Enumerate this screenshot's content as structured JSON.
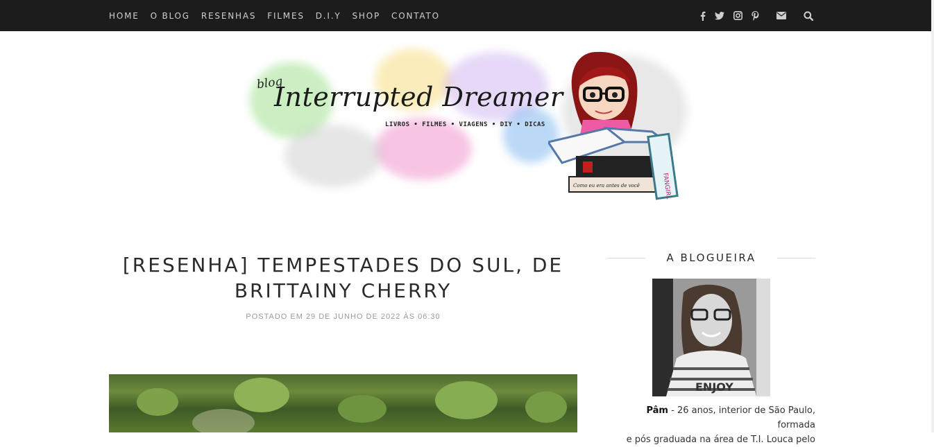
{
  "nav": {
    "items": [
      "HOME",
      "O BLOG",
      "RESENHAS",
      "FILMES",
      "D.I.Y",
      "SHOP",
      "CONTATO"
    ]
  },
  "social": {
    "icons": [
      "facebook-icon",
      "twitter-icon",
      "instagram-icon",
      "pinterest-icon",
      "envelope-icon",
      "search-icon"
    ]
  },
  "header": {
    "blog_word": "blog",
    "logo_title": "Interrupted Dreamer",
    "tagline": "LIVROS • FILMES • VIAGENS • DIY • DICAS",
    "book_spine_1": "Como eu era antes de você",
    "book_spine_2": "FANGIRL"
  },
  "post": {
    "title_line1": "[RESENHA] TEMPESTADES DO SUL, DE",
    "title_line2": "BRITTAINY CHERRY",
    "meta": "POSTADO EM 29 DE JUNHO DE 2022 ÀS 06:30"
  },
  "sidebar": {
    "heading": "A BLOGUEIRA",
    "shirt_text": "ENJOY",
    "bio_name": "Pâm",
    "bio_line1": " - 26 anos, interior de São Paulo, formada",
    "bio_line2": "e pós graduada na área de T.I. Louca pelo"
  }
}
